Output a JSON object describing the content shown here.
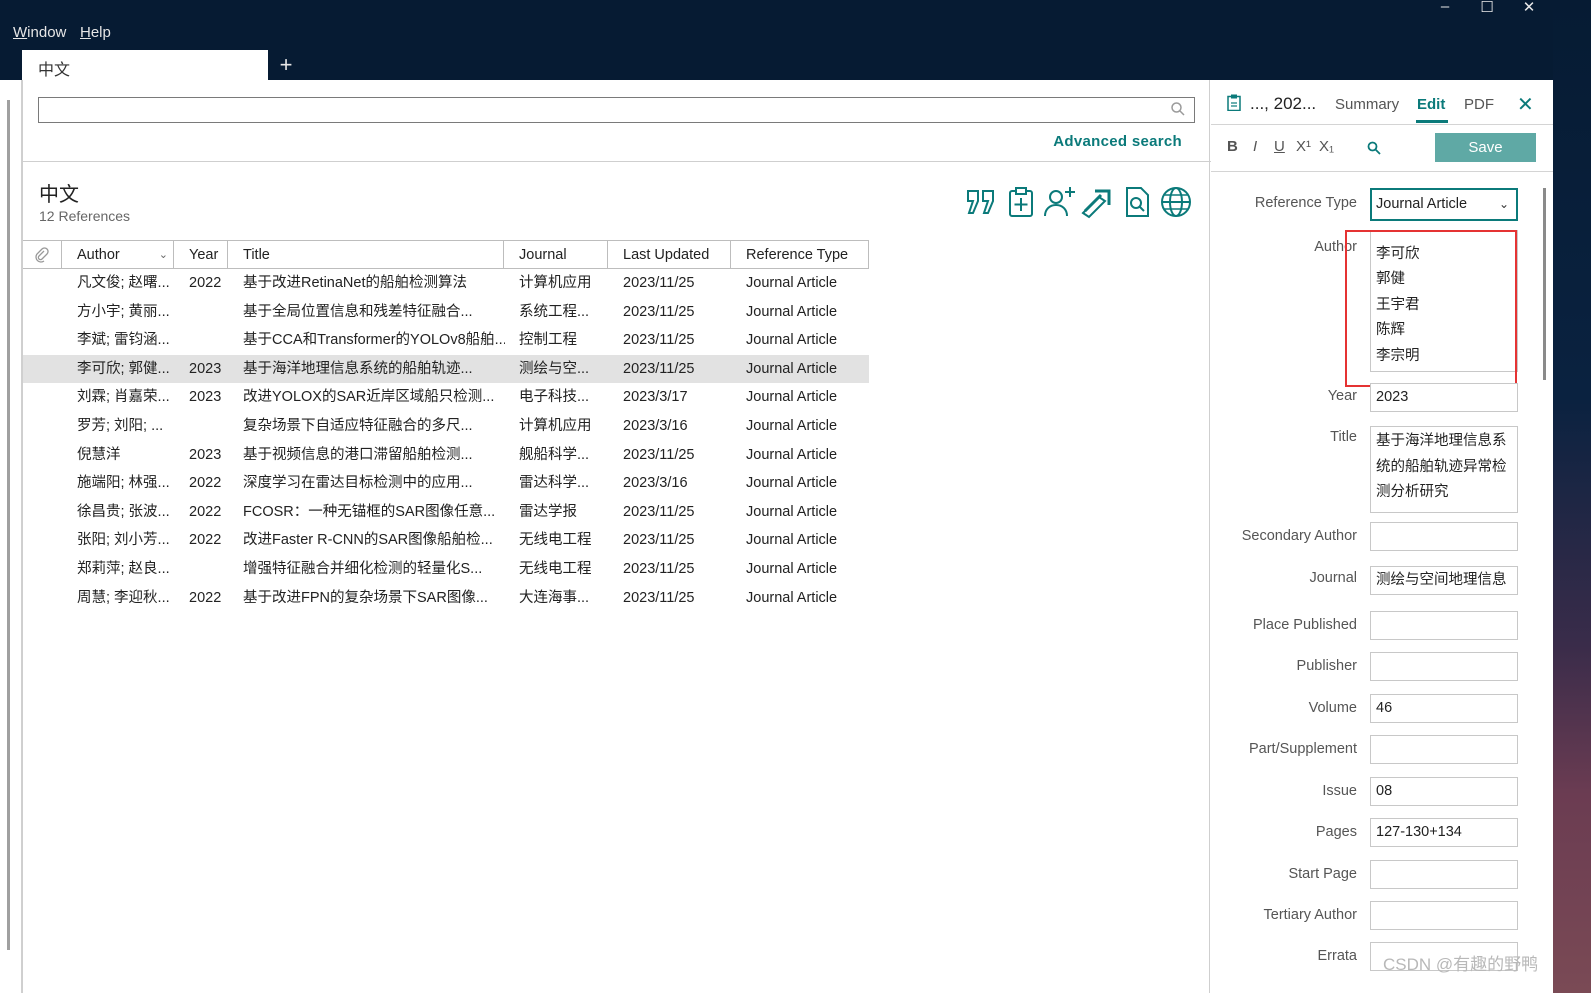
{
  "window": {
    "menu": [
      {
        "label": "Window",
        "underline": "W",
        "rest": "indow"
      },
      {
        "label": "Help",
        "underline": "H",
        "rest": "elp"
      }
    ],
    "controls": {
      "minimize": "–",
      "maximize": "☐",
      "close": "✕"
    },
    "tab": {
      "label": "中文",
      "add": "+"
    }
  },
  "main": {
    "advanced_search": "Advanced search",
    "group_title": "中文",
    "group_count": "12 References",
    "toolbar_icons": [
      "insert-citation-icon",
      "add-to-group-icon",
      "share-icon",
      "export-icon",
      "find-pdf-icon",
      "online-search-icon"
    ],
    "columns": [
      "Author",
      "Year",
      "Title",
      "Journal",
      "Last Updated",
      "Reference Type"
    ],
    "rows": [
      {
        "author": "凡文俊; 赵曙...",
        "year": "2022",
        "title": "基于改进RetinaNet的船舶检测算法",
        "journal": "计算机应用",
        "updated": "2023/11/25",
        "type": "Journal Article"
      },
      {
        "author": "方小宇; 黄丽...",
        "year": "",
        "title": "基于全局位置信息和残差特征融合...",
        "journal": "系统工程...",
        "updated": "2023/11/25",
        "type": "Journal Article"
      },
      {
        "author": "李斌; 雷钧涵...",
        "year": "",
        "title": "基于CCA和Transformer的YOLOv8船舶...",
        "journal": "控制工程",
        "updated": "2023/11/25",
        "type": "Journal Article"
      },
      {
        "author": "李可欣; 郭健...",
        "year": "2023",
        "title": "基于海洋地理信息系统的船舶轨迹...",
        "journal": "测绘与空...",
        "updated": "2023/11/25",
        "type": "Journal Article",
        "selected": true
      },
      {
        "author": "刘霖; 肖嘉荣...",
        "year": "2023",
        "title": "改进YOLOX的SAR近岸区域船只检测...",
        "journal": "电子科技...",
        "updated": "2023/3/17",
        "type": "Journal Article"
      },
      {
        "author": "罗芳; 刘阳; ...",
        "year": "",
        "title": "复杂场景下自适应特征融合的多尺...",
        "journal": "计算机应用",
        "updated": "2023/3/16",
        "type": "Journal Article"
      },
      {
        "author": "倪慧洋",
        "year": "2023",
        "title": "基于视频信息的港口滞留船舶检测...",
        "journal": "舰船科学...",
        "updated": "2023/11/25",
        "type": "Journal Article"
      },
      {
        "author": "施端阳; 林强...",
        "year": "2022",
        "title": "深度学习在雷达目标检测中的应用...",
        "journal": "雷达科学...",
        "updated": "2023/3/16",
        "type": "Journal Article"
      },
      {
        "author": "徐昌贵; 张波...",
        "year": "2022",
        "title": "FCOSR：一种无锚框的SAR图像任意...",
        "journal": "雷达学报",
        "updated": "2023/11/25",
        "type": "Journal Article"
      },
      {
        "author": "张阳; 刘小芳...",
        "year": "2022",
        "title": "改进Faster R-CNN的SAR图像船舶检...",
        "journal": "无线电工程",
        "updated": "2023/11/25",
        "type": "Journal Article"
      },
      {
        "author": "郑莉萍; 赵良...",
        "year": "",
        "title": "增强特征融合并细化检测的轻量化S...",
        "journal": "无线电工程",
        "updated": "2023/11/25",
        "type": "Journal Article"
      },
      {
        "author": "周慧; 李迎秋...",
        "year": "2022",
        "title": "基于改进FPN的复杂场景下SAR图像...",
        "journal": "大连海事...",
        "updated": "2023/11/25",
        "type": "Journal Article"
      }
    ]
  },
  "panel": {
    "short_title": "..., 202...",
    "tabs": [
      "Summary",
      "Edit",
      "PDF"
    ],
    "active_tab": "Edit",
    "format": {
      "bold": "B",
      "italic": "I",
      "underline": "U",
      "superscript": "X¹",
      "subscript": "X₁"
    },
    "save": "Save",
    "reference_type_label": "Reference Type",
    "reference_type_value": "Journal Article",
    "author_label": "Author",
    "authors": [
      "李可欣",
      "郭健",
      "王宇君",
      "陈辉",
      "李宗明"
    ],
    "fields": [
      {
        "label": "Year",
        "value": "2023"
      },
      {
        "label": "Title",
        "value": ""
      },
      {
        "label": "Secondary Author",
        "value": ""
      },
      {
        "label": "Journal",
        "value": "测绘与空间地理信息"
      },
      {
        "label": "Place Published",
        "value": ""
      },
      {
        "label": "Publisher",
        "value": ""
      },
      {
        "label": "Volume",
        "value": "46"
      },
      {
        "label": "Part/Supplement",
        "value": ""
      },
      {
        "label": "Issue",
        "value": "08"
      },
      {
        "label": "Pages",
        "value": "127-130+134"
      },
      {
        "label": "Start Page",
        "value": ""
      },
      {
        "label": "Tertiary Author",
        "value": ""
      },
      {
        "label": "Errata",
        "value": ""
      }
    ],
    "title_lines": [
      "基于海洋地理信息系",
      "统的船舶轨迹异常检",
      "测分析研究"
    ]
  },
  "watermark": "CSDN @有趣的野鸭",
  "colors": {
    "accent": "#0b7a7a",
    "titlebar": "#061b33",
    "save_button": "#5fa9a5",
    "highlight_box": "#e53333",
    "selected_row": "#e2e2e2"
  }
}
